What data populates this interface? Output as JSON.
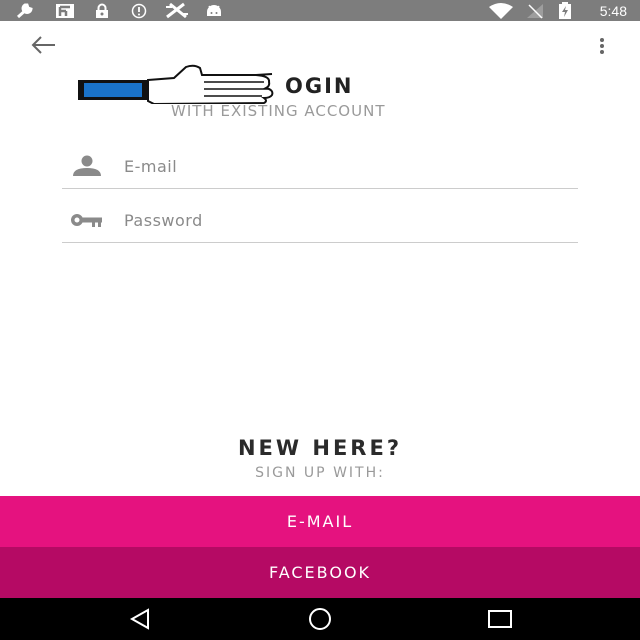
{
  "status_bar": {
    "time": "5:48",
    "icons_left": [
      "wrench-icon",
      "flipboard-icon",
      "lock-icon",
      "info-icon",
      "tools-icon",
      "android-icon"
    ],
    "icons_right": [
      "wifi-icon",
      "signal-off-icon",
      "battery-charging-icon"
    ]
  },
  "app_bar": {
    "back_icon": "arrow-back-icon",
    "menu_icon": "more-vert-icon"
  },
  "header": {
    "logo_icon": "thumbs-up-icon",
    "title": "OGIN",
    "subtitle": "WITH EXISTING ACCOUNT"
  },
  "form": {
    "email": {
      "icon": "person-icon",
      "placeholder": "E-mail",
      "value": ""
    },
    "password": {
      "icon": "key-icon",
      "placeholder": "Password",
      "value": ""
    }
  },
  "signup": {
    "heading": "NEW HERE?",
    "subheading": "SIGN UP WITH:",
    "email_button": "E-MAIL",
    "facebook_button": "FACEBOOK"
  },
  "colors": {
    "status_bar": "#7d7d7d",
    "email_button": "#e5127f",
    "facebook_button": "#b50a64",
    "nav_bar": "#000000"
  },
  "nav_bar": {
    "icons": [
      "back-triangle-icon",
      "home-circle-icon",
      "recents-square-icon"
    ]
  }
}
